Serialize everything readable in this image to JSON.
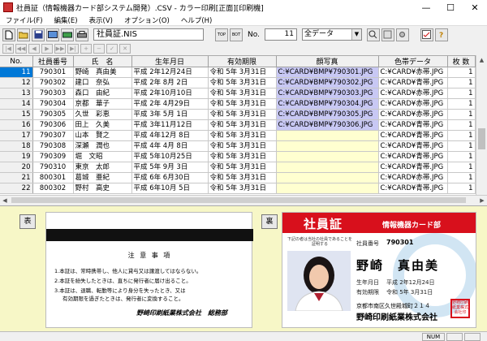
{
  "window": {
    "title": "社員証（情報機器カード部システム開発）.CSV - カラー印刷[正面][印刷機]",
    "min": "—",
    "max": "☐",
    "close": "✕"
  },
  "menu": [
    "ファイル(F)",
    "編集(E)",
    "表示(V)",
    "オプション(O)",
    "ヘルプ(H)"
  ],
  "toolbar": {
    "filename": "社員証.NIS",
    "no_label": "No.",
    "no_value": "11",
    "range_select": "全データ",
    "arrow_down": "▼",
    "top_label": "TOP",
    "bot_label": "BOT"
  },
  "grid": {
    "headers": [
      "No.",
      "社員番号",
      "氏　名",
      "生年月日",
      "有効期限",
      "顔写真",
      "色帯データ",
      "枚 数"
    ],
    "rows": [
      [
        "11",
        "790301",
        "野崎　真由美",
        "平成 2年12月24日",
        "令和 5年 3月31日",
        "C:¥CARD¥BMP¥790301.JPG",
        "C:¥CARD¥赤帯.JPG",
        "1"
      ],
      [
        "12",
        "790302",
        "建口　奈弘",
        "平成 2年 8月 2日",
        "令和 5年 3月31日",
        "C:¥CARD¥BMP¥790302.JPG",
        "C:¥CARD¥青帯.JPG",
        "1"
      ],
      [
        "13",
        "790303",
        "森口　由紀",
        "平成 2年10月10日",
        "令和 5年 3月31日",
        "C:¥CARD¥BMP¥790303.JPG",
        "C:¥CARD¥赤帯.JPG",
        "1"
      ],
      [
        "14",
        "790304",
        "京都　華子",
        "平成 2年 4月29日",
        "令和 5年 3月31日",
        "C:¥CARD¥BMP¥790304.JPG",
        "C:¥CARD¥赤帯.JPG",
        "1"
      ],
      [
        "15",
        "790305",
        "久世　彩恵",
        "平成 3年 5月 1日",
        "令和 5年 3月31日",
        "C:¥CARD¥BMP¥790305.JPG",
        "C:¥CARD¥赤帯.JPG",
        "1"
      ],
      [
        "16",
        "790306",
        "田上　久美",
        "平成 3年11月12日",
        "令和 5年 3月31日",
        "C:¥CARD¥BMP¥790306.JPG",
        "C:¥CARD¥青帯.JPG",
        "1"
      ],
      [
        "17",
        "790307",
        "山本　賢之",
        "平成 4年12月 8日",
        "令和 5年 3月31日",
        "",
        "C:¥CARD¥青帯.JPG",
        "1"
      ],
      [
        "18",
        "790308",
        "深瀬　潤也",
        "平成 4年 4月 8日",
        "令和 5年 3月31日",
        "",
        "C:¥CARD¥青帯.JPG",
        "1"
      ],
      [
        "19",
        "790309",
        "堀　文昭",
        "平成 5年10月25日",
        "令和 5年 3月31日",
        "",
        "C:¥CARD¥青帯.JPG",
        "1"
      ],
      [
        "20",
        "790310",
        "東京　太郎",
        "平成 5年 9月 3日",
        "令和 5年 3月31日",
        "",
        "C:¥CARD¥青帯.JPG",
        "1"
      ],
      [
        "21",
        "800301",
        "葛城　亜紀",
        "平成 6年 6月30日",
        "令和 5年 3月31日",
        "",
        "C:¥CARD¥赤帯.JPG",
        "1"
      ],
      [
        "22",
        "800302",
        "野村　高史",
        "平成 6年10月 5日",
        "令和 5年 3月31日",
        "",
        "C:¥CARD¥青帯.JPG",
        "1"
      ]
    ]
  },
  "preview": {
    "front_button": "表",
    "back_button": "裏",
    "back_card": {
      "notes_title": "注 意 事 項",
      "notes": [
        "1.本証は、常時携帯し、他人に貸与又は譲渡してはならない。",
        "2.本証を紛失したときは、直ちに発行者に届け出ること。",
        "3.本証は、退職、転勤等により身分を失ったとき、又は",
        "有効期限を過ぎたときは、発行者に変換すること。"
      ],
      "signature": "野崎印刷紙業株式会社　総務部"
    },
    "front_card": {
      "title": "社員証",
      "subtitle": "情報機器カード部",
      "note": "下記の者は当社の社員であることを証明する",
      "emp_no_label": "社員番号",
      "emp_no": "790301",
      "name": "野崎　真由美",
      "birth_label": "生年月日",
      "birth": "平成 2年12月24日",
      "expiry_label": "有効期限",
      "expiry": "令和 5年 3月31日",
      "address": "京都市南区久世殿城町２１４",
      "company": "野崎印刷紙業株式会社",
      "stamp": "野崎印刷紙業株式会社印"
    }
  },
  "status": {
    "num": "NUM"
  },
  "colors": {
    "accent_red": "#d8101c",
    "selection": "#0078d7",
    "photo_cell": "#c8c8f4",
    "empty_photo_cell": "#ffffd0"
  }
}
